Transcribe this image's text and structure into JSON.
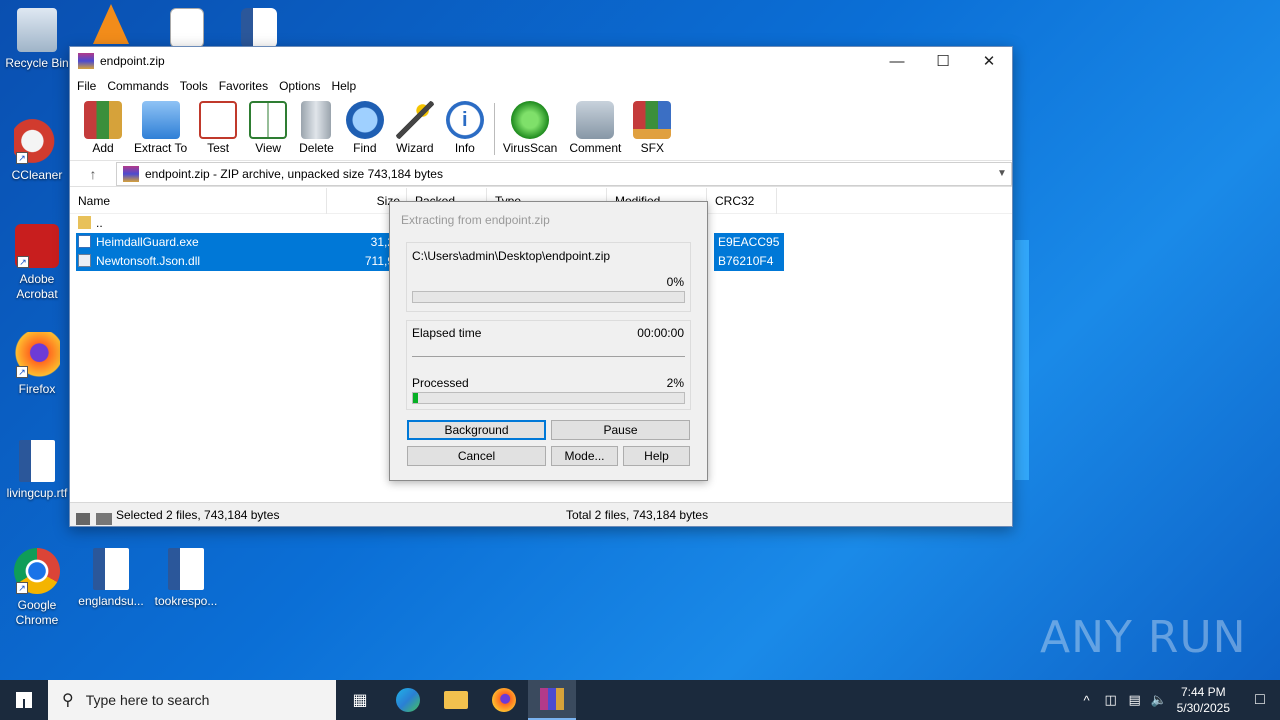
{
  "desktop": {
    "icons": [
      {
        "label": "Recycle Bin"
      },
      {
        "label": "CCleaner"
      },
      {
        "label": "Adobe Acrobat"
      },
      {
        "label": "Firefox"
      },
      {
        "label": "livingcup.rtf"
      },
      {
        "label": "Google Chrome"
      },
      {
        "label": "englandsu..."
      },
      {
        "label": "tookrespo..."
      }
    ],
    "watermark": "ANY RUN"
  },
  "window": {
    "title": "endpoint.zip",
    "menu": [
      "File",
      "Commands",
      "Tools",
      "Favorites",
      "Options",
      "Help"
    ],
    "toolbar": [
      "Add",
      "Extract To",
      "Test",
      "View",
      "Delete",
      "Find",
      "Wizard",
      "Info",
      "VirusScan",
      "Comment",
      "SFX"
    ],
    "address": "endpoint.zip - ZIP archive, unpacked size 743,184 bytes",
    "columns": [
      "Name",
      "Size",
      "Packed",
      "Type",
      "Modified",
      "CRC32"
    ],
    "rows": [
      {
        "name": "..",
        "size": "",
        "crc": ""
      },
      {
        "name": "HeimdallGuard.exe",
        "size": "31,2",
        "crc": "E9EACC95"
      },
      {
        "name": "Newtonsoft.Json.dll",
        "size": "711,9",
        "crc": "B76210F4"
      }
    ],
    "status_left": "Selected 2 files, 743,184 bytes",
    "status_right": "Total 2 files, 743,184 bytes"
  },
  "dialog": {
    "title": "Extracting from endpoint.zip",
    "path": "C:\\Users\\admin\\Desktop\\endpoint.zip",
    "file_progress_text": "0%",
    "file_progress": 0,
    "elapsed_label": "Elapsed time",
    "elapsed_value": "00:00:00",
    "processed_label": "Processed",
    "processed_text": "2%",
    "processed_progress": 0.02,
    "buttons": {
      "background": "Background",
      "pause": "Pause",
      "cancel": "Cancel",
      "mode": "Mode...",
      "help": "Help"
    }
  },
  "taskbar": {
    "search_placeholder": "Type here to search",
    "time": "7:44 PM",
    "date": "5/30/2025"
  }
}
